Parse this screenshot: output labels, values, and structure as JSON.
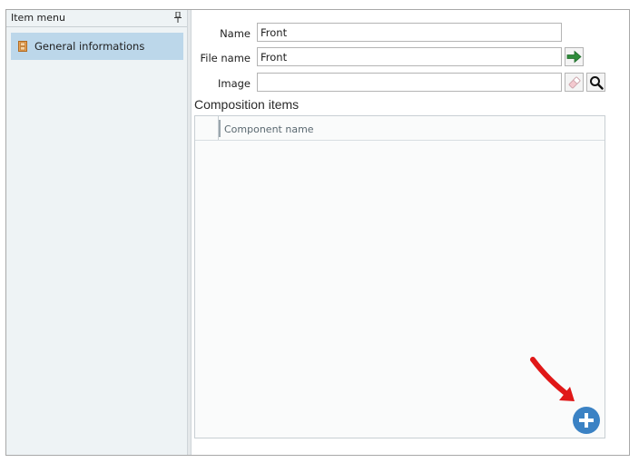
{
  "left_panel": {
    "header_title": "Item menu",
    "items": [
      {
        "label": "General informations",
        "selected": true,
        "icon": "door-icon"
      }
    ]
  },
  "form": {
    "name": {
      "label": "Name",
      "value": "Front"
    },
    "file_name": {
      "label": "File name",
      "value": "Front"
    },
    "image": {
      "label": "Image",
      "value": ""
    }
  },
  "composition": {
    "title": "Composition items",
    "columns": [
      "Component name"
    ],
    "rows": []
  },
  "colors": {
    "selected_item": "#bcd7ea",
    "add_button": "#3b82c4",
    "go_arrow": "#2e8b3a",
    "annotation_arrow": "#e01818"
  }
}
